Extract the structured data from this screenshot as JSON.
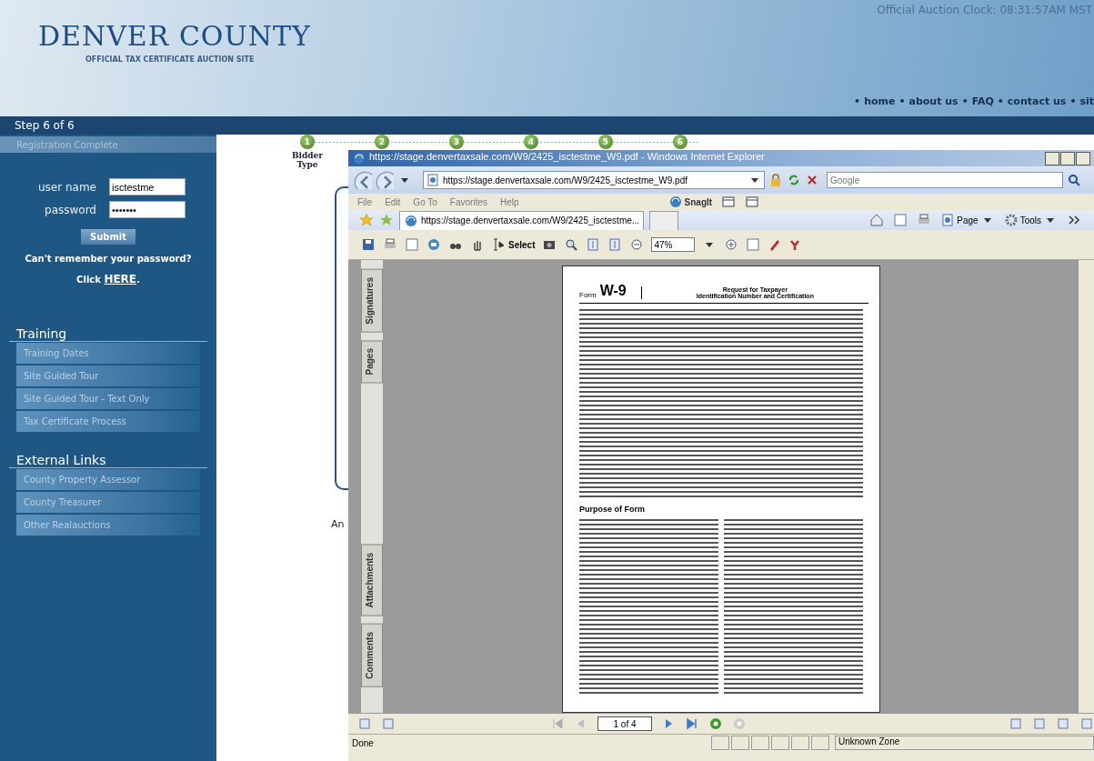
{
  "header": {
    "logo_title": "DENVER COUNTY",
    "logo_subtitle": "OFFICIAL TAX CERTIFICATE AUCTION SITE",
    "clock": "Official Auction Clock: 08:31:57AM MST",
    "separator": "•",
    "nav_links": [
      "home",
      "about us",
      "FAQ",
      "contact us",
      "sit"
    ]
  },
  "step_bar": {
    "label": "Step 6 of 6"
  },
  "sidebar": {
    "status_item": "Registration Complete",
    "login": {
      "username_label": "user name",
      "username_value": "isctestme",
      "password_label": "password",
      "password_value": "•••••••",
      "submit": "Submit",
      "forgot_text": "Can't remember your password?",
      "forgot_prefix": "Click",
      "forgot_link": "HERE",
      "forgot_suffix": "."
    },
    "sections": [
      {
        "heading": "Training",
        "items": [
          "Training Dates",
          "Site Guided Tour",
          "Site Guided Tour - Text Only",
          "Tax Certificate Process"
        ]
      },
      {
        "heading": "External Links",
        "items": [
          "County Property Assessor",
          "County Treasurer",
          "Other Realauctions"
        ]
      }
    ]
  },
  "steps": [
    {
      "number": "1",
      "label": "Bidder Type"
    },
    {
      "number": "2"
    },
    {
      "number": "3"
    },
    {
      "number": "4"
    },
    {
      "number": "5"
    },
    {
      "number": "6"
    }
  ],
  "main_text_fragment": "An",
  "browser": {
    "title": "https://stage.denvertaxsale.com/W9/2425_isctestme_W9.pdf - Windows Internet Explorer",
    "address": "https://stage.denvertaxsale.com/W9/2425_isctestme_W9.pdf",
    "search_placeholder": "Google",
    "menu": [
      "File",
      "Edit",
      "Go To",
      "Favorites",
      "Help"
    ],
    "snagit": "SnagIt",
    "tabs": [
      {
        "title": "https://stage.denvertaxsale.com/W9/2425_isctestme...",
        "selected": true
      }
    ],
    "command_bar": [
      "Page",
      "Tools"
    ],
    "pdf_toolbar": {
      "select_label": "Select",
      "zoom": "47%"
    },
    "side_tabs": [
      "Signatures",
      "Pages",
      "Attachments",
      "Comments"
    ],
    "document": {
      "form_prefix": "Form",
      "form_number": "W-9",
      "title_line1": "Request for Taxpayer",
      "title_line2": "Identification Number and Certification",
      "purpose_heading": "Purpose of Form"
    },
    "page_nav": "1 of 4",
    "status": {
      "text": "Done",
      "zone": "Unknown Zone"
    }
  }
}
